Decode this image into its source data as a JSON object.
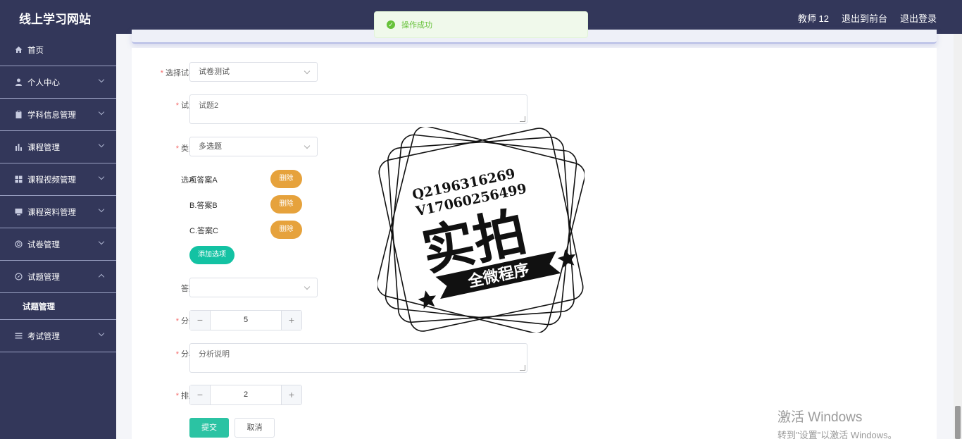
{
  "header": {
    "brand": "线上学习网站",
    "user": "教师 12",
    "to_front": "退出到前台",
    "logout": "退出登录"
  },
  "toast": {
    "message": "操作成功",
    "icon": "check-circle-icon",
    "color": "#67c23a"
  },
  "sidebar": {
    "items": [
      {
        "label": "首页",
        "icon": "home-icon"
      },
      {
        "label": "个人中心",
        "icon": "user-icon"
      },
      {
        "label": "学科信息管理",
        "icon": "clipboard-icon"
      },
      {
        "label": "课程管理",
        "icon": "bar-chart-icon"
      },
      {
        "label": "课程视频管理",
        "icon": "grid-icon"
      },
      {
        "label": "课程资料管理",
        "icon": "monitor-icon"
      },
      {
        "label": "试卷管理",
        "icon": "circle-icon"
      },
      {
        "label": "试题管理",
        "icon": "compass-icon"
      },
      {
        "label": "试题管理"
      },
      {
        "label": "考试管理",
        "icon": "menu-icon"
      }
    ]
  },
  "form": {
    "paper": {
      "label": "选择试卷",
      "value": "试卷测试"
    },
    "question": {
      "label": "试题",
      "value": "试题2"
    },
    "type": {
      "label": "类型",
      "value": "多选题"
    },
    "options": {
      "label": "选项",
      "items": [
        "A.答案A",
        "B.答案B",
        "C.答案C"
      ],
      "delete_label": "删除",
      "add_label": "添加选项"
    },
    "answer": {
      "label": "答案",
      "value": ""
    },
    "score": {
      "label": "分数",
      "value": "5"
    },
    "analysis": {
      "label": "分析",
      "value": "分析说明"
    },
    "order": {
      "label": "排序",
      "value": "2"
    },
    "submit": "提交",
    "cancel": "取消"
  },
  "watermark": {
    "line1": "Q2196316269",
    "line2": "V17060256499",
    "main": "实拍",
    "banner": "全微程序"
  },
  "os": {
    "activate_title": "激活 Windows",
    "activate_sub": "转到\"设置\"以激活 Windows。"
  },
  "colors": {
    "sidebar_bg": "#33375a",
    "accent_green": "#2bc3a3",
    "delete_orange": "#e6a23c",
    "required_red": "#f56c6c"
  }
}
